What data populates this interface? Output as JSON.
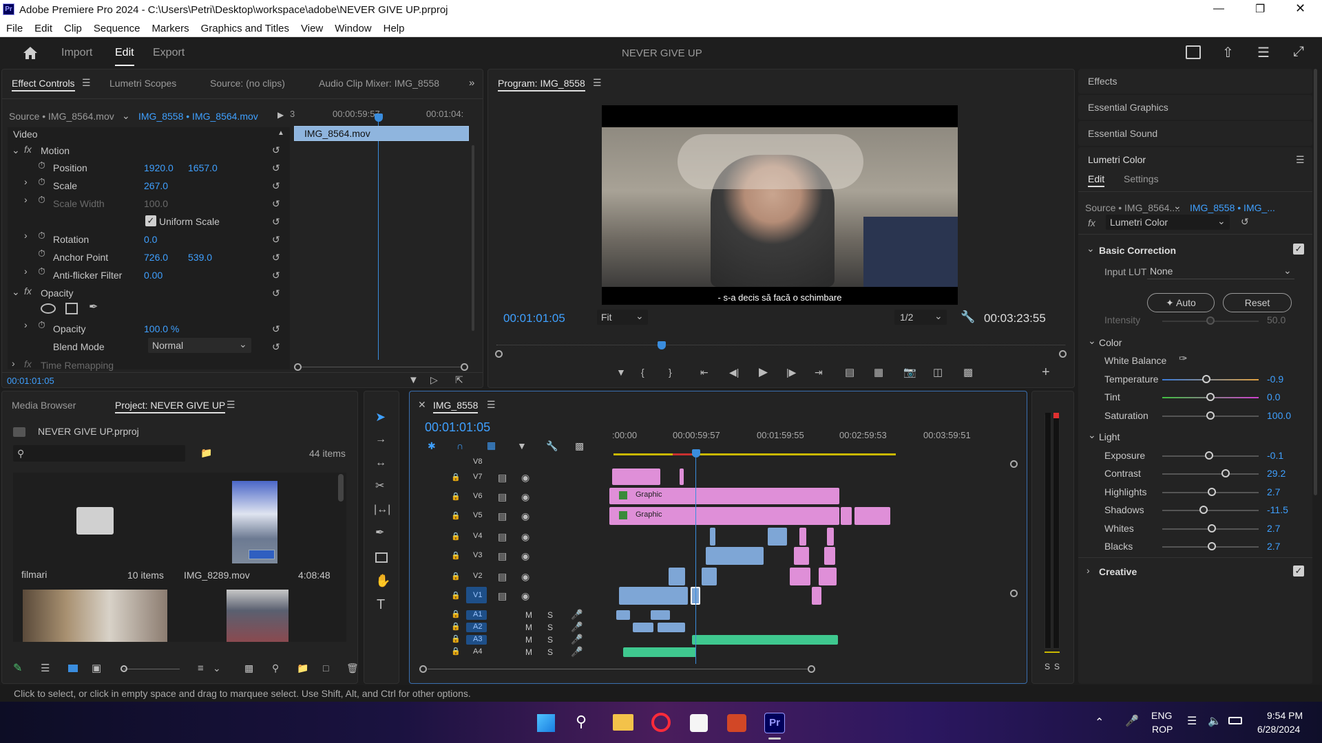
{
  "window": {
    "title": "Adobe Premiere Pro 2024 - C:\\Users\\Petri\\Desktop\\workspace\\adobe\\NEVER GIVE UP.prproj",
    "app_badge": "Pr"
  },
  "menu": [
    "File",
    "Edit",
    "Clip",
    "Sequence",
    "Markers",
    "Graphics and Titles",
    "View",
    "Window",
    "Help"
  ],
  "header": {
    "tabs": [
      "Import",
      "Edit",
      "Export"
    ],
    "active": "Edit",
    "project_title": "NEVER GIVE UP"
  },
  "source_panel": {
    "tabs": [
      "Effect Controls",
      "Lumetri Scopes",
      "Source: (no clips)",
      "Audio Clip Mixer: IMG_8558"
    ],
    "source_label": "Source • IMG_8564.mov",
    "sequence_label": "IMG_8558 • IMG_8564.mov",
    "ruler": [
      "00:00:59:57",
      "00:01:04:"
    ],
    "ruler_start": "3",
    "clip_name": "IMG_8564.mov",
    "section_video": "Video",
    "motion": "Motion",
    "position": {
      "label": "Position",
      "x": "1920.0",
      "y": "1657.0"
    },
    "scale": {
      "label": "Scale",
      "value": "267.0"
    },
    "scale_width": {
      "label": "Scale Width",
      "value": "100.0"
    },
    "uniform_scale": "Uniform Scale",
    "rotation": {
      "label": "Rotation",
      "value": "0.0"
    },
    "anchor": {
      "label": "Anchor Point",
      "x": "726.0",
      "y": "539.0"
    },
    "antiflicker": {
      "label": "Anti-flicker Filter",
      "value": "0.00"
    },
    "opacity_section": "Opacity",
    "opacity": {
      "label": "Opacity",
      "value": "100.0 %"
    },
    "blend": {
      "label": "Blend Mode",
      "value": "Normal"
    },
    "time_remap": "Time Remapping",
    "timecode": "00:01:01:05"
  },
  "program": {
    "title": "Program: IMG_8558",
    "subtitle": "- s-a decis să facă o schimbare",
    "timecode": "00:01:01:05",
    "fit": "Fit",
    "quality": "1/2",
    "duration": "00:03:23:55"
  },
  "project": {
    "tabs": [
      "Media Browser",
      "Project: NEVER GIVE UP"
    ],
    "file": "NEVER GIVE UP.prproj",
    "items_count": "44 items",
    "bin": {
      "name": "filmari",
      "count": "10 items"
    },
    "clip": {
      "name": "IMG_8289.mov",
      "duration": "4:08:48"
    }
  },
  "timeline": {
    "seq_name": "IMG_8558",
    "timecode": "00:01:01:05",
    "ruler": [
      ":00:00",
      "00:00:59:57",
      "00:01:59:55",
      "00:02:59:53",
      "00:03:59:51"
    ],
    "video_tracks": [
      "V8",
      "V7",
      "V6",
      "V5",
      "V4",
      "V3",
      "V2",
      "V1"
    ],
    "audio_tracks": [
      "A1",
      "A2",
      "A3",
      "A4"
    ],
    "graphic_label": "Graphic",
    "m": "M",
    "s": "S"
  },
  "lumetri": {
    "panels": [
      "Effects",
      "Essential Graphics",
      "Essential Sound"
    ],
    "title": "Lumetri Color",
    "tabs": [
      "Edit",
      "Settings"
    ],
    "source": "Source • IMG_8564....",
    "target": "IMG_8558 • IMG_...",
    "effect": "Lumetri Color",
    "basic": "Basic Correction",
    "input_lut_label": "Input LUT",
    "input_lut": "None",
    "auto": "Auto",
    "reset": "Reset",
    "intensity": {
      "label": "Intensity",
      "value": "50.0"
    },
    "color": "Color",
    "white_balance": "White Balance",
    "sliders": [
      {
        "label": "Temperature",
        "value": "-0.9",
        "pos": 0.48
      },
      {
        "label": "Tint",
        "value": "0.0",
        "pos": 0.5
      },
      {
        "label": "Saturation",
        "value": "100.0",
        "pos": 0.5
      }
    ],
    "light": "Light",
    "light_sliders": [
      {
        "label": "Exposure",
        "value": "-0.1",
        "pos": 0.49
      },
      {
        "label": "Contrast",
        "value": "29.2",
        "pos": 0.66
      },
      {
        "label": "Highlights",
        "value": "2.7",
        "pos": 0.52
      },
      {
        "label": "Shadows",
        "value": "-11.5",
        "pos": 0.44
      },
      {
        "label": "Whites",
        "value": "2.7",
        "pos": 0.52
      },
      {
        "label": "Blacks",
        "value": "2.7",
        "pos": 0.52
      }
    ],
    "creative": "Creative"
  },
  "status_bar": "Click to select, or click in empty space and drag to marquee select. Use Shift, Alt, and Ctrl for other options.",
  "taskbar": {
    "lang1": "ENG",
    "lang2": "ROP",
    "time": "9:54 PM",
    "date": "6/28/2024",
    "meter_s": "S"
  },
  "colors": {
    "accent": "#3fa0ff",
    "graphic": "#df8fd8",
    "video": "#7ea6d6",
    "audio": "#3fc88f",
    "playhead": "#3a8dde"
  }
}
